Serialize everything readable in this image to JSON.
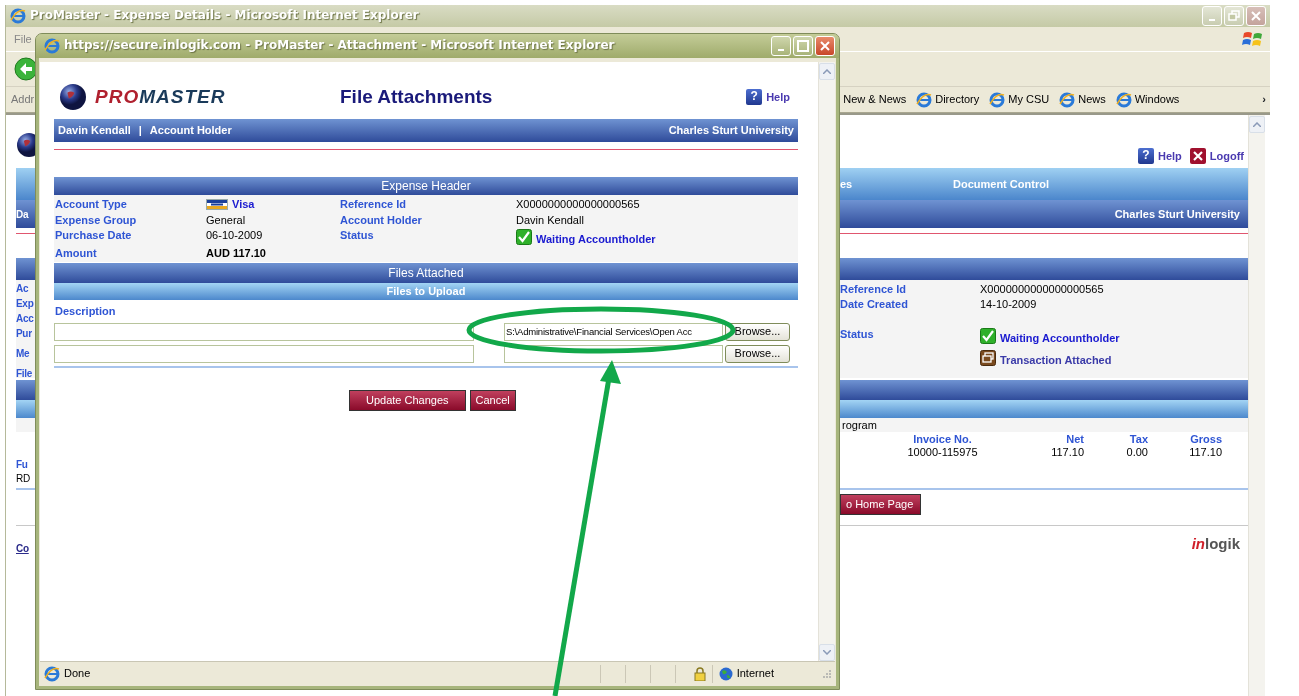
{
  "background_window": {
    "title": "ProMaster - Expense Details - Microsoft Internet Explorer",
    "menu": [
      "File"
    ],
    "address_label": "Addr",
    "links": [
      "New & News",
      "Directory",
      "My CSU",
      "News",
      "Windows"
    ],
    "links_more": "›"
  },
  "background_page": {
    "help": "Help",
    "help_icon": "?",
    "logoff": "Logoff",
    "nav_tabs": [
      "es",
      "Document Control"
    ],
    "user_fragment": "Da",
    "organization": "Charles Sturt University",
    "detail_fragments": [
      "Ac",
      "Exp",
      "Acc",
      "Pur",
      "Me",
      "File"
    ],
    "details": [
      {
        "label": "Reference Id",
        "values": [
          {
            "kind": "text",
            "text": "X0000000000000000565"
          }
        ]
      },
      {
        "label": "Date Created",
        "values": [
          {
            "kind": "text",
            "text": "14-10-2009"
          }
        ]
      },
      {
        "label": "Status",
        "values": [
          {
            "kind": "approved",
            "text": "Waiting Accountholder"
          },
          {
            "kind": "attached",
            "text": "Transaction Attached"
          }
        ]
      }
    ],
    "program_text": "rogram",
    "table": {
      "columns": [
        "Invoice No.",
        "Net",
        "Tax",
        "Gross"
      ],
      "rows": [
        [
          "10000-115975",
          "117.10",
          "0.00",
          "117.10"
        ]
      ]
    },
    "fund_fragments": [
      "Fu",
      "RD"
    ],
    "home_button": "o Home Page",
    "link_fragment": "Co",
    "logo_parts": [
      "in",
      "logik"
    ]
  },
  "popup": {
    "title": "https://secure.inlogik.com - ProMaster - Attachment - Microsoft Internet Explorer",
    "logo_parts": [
      "PRO",
      "MASTER"
    ],
    "heading": "File Attachments",
    "help": "Help",
    "help_icon": "?",
    "user": "Davin Kendall",
    "separator": "|",
    "role": "Account Holder",
    "organization": "Charles Sturt University",
    "expense_header": "Expense Header",
    "details": [
      [
        {
          "label": "Account Type",
          "kind": "card",
          "value": "Visa"
        },
        {
          "label": "Reference Id",
          "kind": "text",
          "value": "X0000000000000000565"
        }
      ],
      [
        {
          "label": "Expense Group",
          "kind": "text",
          "value": "General"
        },
        {
          "label": "Account Holder",
          "kind": "text",
          "value": "Davin Kendall"
        }
      ],
      [
        {
          "label": "Purchase Date",
          "kind": "text",
          "value": "06-10-2009"
        },
        {
          "label": "Status",
          "kind": "approved",
          "value": "Waiting Accountholder"
        }
      ],
      [
        {
          "label": "Amount",
          "kind": "bold",
          "value": "AUD 117.10"
        }
      ]
    ],
    "files_attached": "Files Attached",
    "files_to_upload": "Files to Upload",
    "description_label": "Description",
    "uploads": [
      {
        "file": "S:\\Administrative\\Financial Services\\Open Acc",
        "browse": "Browse..."
      },
      {
        "browse": "Browse..."
      }
    ],
    "buttons": [
      {
        "kind": "primary",
        "label": "Update Changes"
      },
      {
        "kind": "secondary",
        "label": "Cancel"
      }
    ],
    "status_bar": {
      "text": "Done",
      "zone": "Internet"
    }
  }
}
